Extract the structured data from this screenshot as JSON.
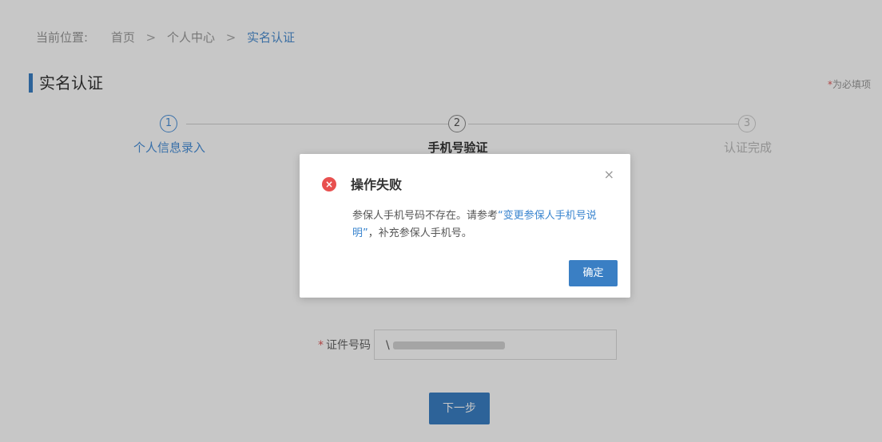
{
  "breadcrumb": {
    "label": "当前位置:",
    "items": [
      "首页",
      "个人中心",
      "实名认证"
    ],
    "separator": ">"
  },
  "page": {
    "title": "实名认证",
    "required_note_star": "*",
    "required_note": "为必填项"
  },
  "steps": [
    {
      "number": "1",
      "label": "个人信息录入",
      "status": "done"
    },
    {
      "number": "2",
      "label": "手机号验证",
      "status": "current"
    },
    {
      "number": "3",
      "label": "认证完成",
      "status": "pending"
    }
  ],
  "form": {
    "required_star": "*",
    "id_number_label": "证件号码",
    "id_number_value": "\\",
    "next_button": "下一步"
  },
  "dialog": {
    "icon": "error-x-icon",
    "icon_glyph": "×",
    "title": "操作失败",
    "close_glyph": "×",
    "message_before": "参保人手机号码不存在。请参考",
    "link_text": "“变更参保人手机号说明”",
    "message_after": "，补充参保人手机号。",
    "ok_button": "确定"
  },
  "colors": {
    "accent": "#3a7fc4",
    "error": "#e8504f",
    "required": "#e05a5a"
  }
}
